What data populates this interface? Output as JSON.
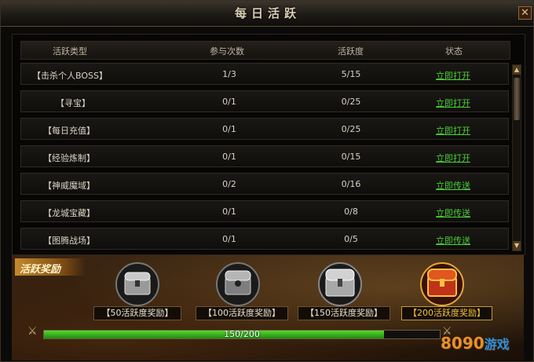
{
  "window": {
    "title": "每日活跃",
    "close_label": "✕"
  },
  "table": {
    "headers": [
      "活跃类型",
      "参与次数",
      "活跃度",
      "状态"
    ],
    "rows": [
      {
        "name": "【击杀个人BOSS】",
        "count": "1/3",
        "activity": "5/15",
        "action": "立即打开"
      },
      {
        "name": "【寻宝】",
        "count": "0/1",
        "activity": "0/25",
        "action": "立即打开"
      },
      {
        "name": "【每日充值】",
        "count": "0/1",
        "activity": "0/25",
        "action": "立即打开"
      },
      {
        "name": "【经验炼制】",
        "count": "0/1",
        "activity": "0/15",
        "action": "立即打开"
      },
      {
        "name": "【神威魔域】",
        "count": "0/2",
        "activity": "0/16",
        "action": "立即传送"
      },
      {
        "name": "【龙城宝藏】",
        "count": "0/1",
        "activity": "0/8",
        "action": "立即传送"
      },
      {
        "name": "【图腾战场】",
        "count": "0/1",
        "activity": "0/5",
        "action": "立即传送"
      }
    ]
  },
  "scrollbar": {
    "up_label": "▲",
    "down_label": "▼"
  },
  "rewards": {
    "tag_label": "活跃奖励",
    "items": [
      {
        "label": "【50活跃度奖励】",
        "highlight": false
      },
      {
        "label": "【100活跃度奖励】",
        "highlight": false
      },
      {
        "label": "【150活跃度奖励】",
        "highlight": false
      },
      {
        "label": "【200活跃度奖励】",
        "highlight": true
      }
    ],
    "progress": {
      "current": 150,
      "max": 200,
      "text": "150/200",
      "fill_fraction": 0.86
    }
  },
  "watermark": {
    "text": "8090",
    "suffix": "游戏"
  },
  "colors": {
    "accent_green": "#4bcf36",
    "gold": "#f7c240",
    "frame": "#5a4a33"
  }
}
